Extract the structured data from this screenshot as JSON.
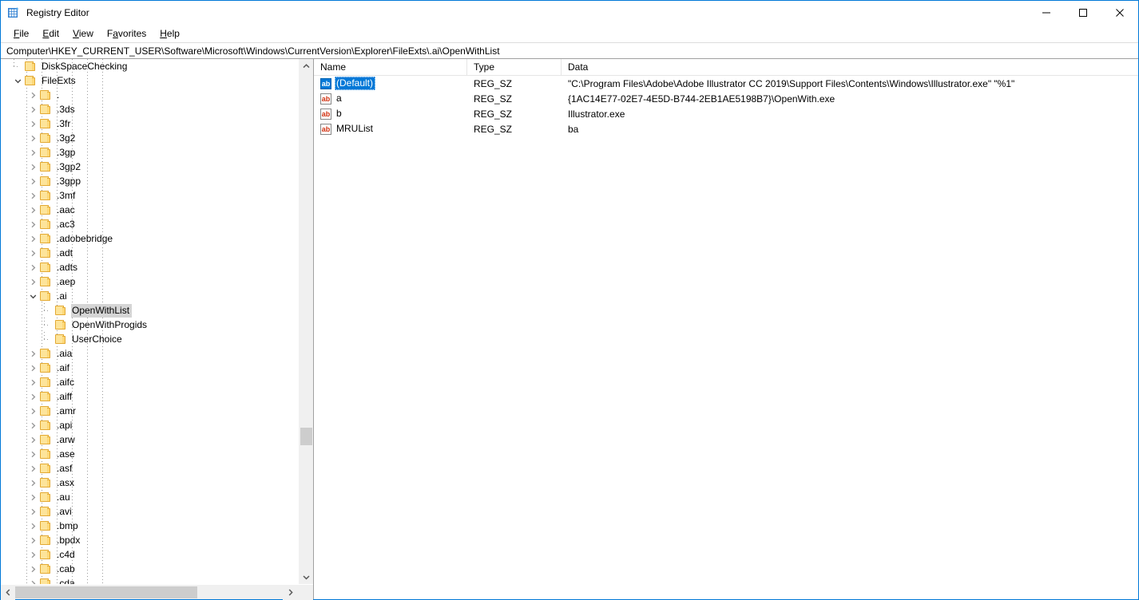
{
  "window": {
    "title": "Registry Editor",
    "app_icon": "registry-grid-icon",
    "minimize_label": "Minimize",
    "maximize_label": "Maximize",
    "close_label": "Close",
    "border_color": "#0078d7"
  },
  "menubar": {
    "items": [
      {
        "label": "File",
        "accesskey": "F"
      },
      {
        "label": "Edit",
        "accesskey": "E"
      },
      {
        "label": "View",
        "accesskey": "V"
      },
      {
        "label": "Favorites",
        "accesskey": "a"
      },
      {
        "label": "Help",
        "accesskey": "H"
      }
    ]
  },
  "addressbar": {
    "path": "Computer\\HKEY_CURRENT_USER\\Software\\Microsoft\\Windows\\CurrentVersion\\Explorer\\FileExts\\.ai\\OpenWithList"
  },
  "tree": {
    "selected_key": "OpenWithList",
    "ancestor_guide_count": 6,
    "nodes": [
      {
        "label": "DiskSpaceChecking",
        "indent": 6,
        "state": "leaf-elbow",
        "selected": false
      },
      {
        "label": "FileExts",
        "indent": 6,
        "state": "expanded",
        "selected": false
      },
      {
        "label": ".",
        "indent": 7,
        "state": "collapsed",
        "selected": false
      },
      {
        "label": ".3ds",
        "indent": 7,
        "state": "collapsed",
        "selected": false
      },
      {
        "label": ".3fr",
        "indent": 7,
        "state": "collapsed",
        "selected": false
      },
      {
        "label": ".3g2",
        "indent": 7,
        "state": "collapsed",
        "selected": false
      },
      {
        "label": ".3gp",
        "indent": 7,
        "state": "collapsed",
        "selected": false
      },
      {
        "label": ".3gp2",
        "indent": 7,
        "state": "collapsed",
        "selected": false
      },
      {
        "label": ".3gpp",
        "indent": 7,
        "state": "collapsed",
        "selected": false
      },
      {
        "label": ".3mf",
        "indent": 7,
        "state": "collapsed",
        "selected": false
      },
      {
        "label": ".aac",
        "indent": 7,
        "state": "collapsed",
        "selected": false
      },
      {
        "label": ".ac3",
        "indent": 7,
        "state": "collapsed",
        "selected": false
      },
      {
        "label": ".adobebridge",
        "indent": 7,
        "state": "collapsed",
        "selected": false
      },
      {
        "label": ".adt",
        "indent": 7,
        "state": "collapsed",
        "selected": false
      },
      {
        "label": ".adts",
        "indent": 7,
        "state": "collapsed",
        "selected": false
      },
      {
        "label": ".aep",
        "indent": 7,
        "state": "collapsed",
        "selected": false
      },
      {
        "label": ".ai",
        "indent": 7,
        "state": "expanded",
        "selected": false
      },
      {
        "label": "OpenWithList",
        "indent": 8,
        "state": "leaf-elbow",
        "selected": true
      },
      {
        "label": "OpenWithProgids",
        "indent": 8,
        "state": "leaf-elbow",
        "selected": false
      },
      {
        "label": "UserChoice",
        "indent": 8,
        "state": "leaf-elbow-last",
        "selected": false
      },
      {
        "label": ".aia",
        "indent": 7,
        "state": "collapsed",
        "selected": false
      },
      {
        "label": ".aif",
        "indent": 7,
        "state": "collapsed",
        "selected": false
      },
      {
        "label": ".aifc",
        "indent": 7,
        "state": "collapsed",
        "selected": false
      },
      {
        "label": ".aiff",
        "indent": 7,
        "state": "collapsed",
        "selected": false
      },
      {
        "label": ".amr",
        "indent": 7,
        "state": "collapsed",
        "selected": false
      },
      {
        "label": ".api",
        "indent": 7,
        "state": "collapsed",
        "selected": false
      },
      {
        "label": ".arw",
        "indent": 7,
        "state": "collapsed",
        "selected": false
      },
      {
        "label": ".ase",
        "indent": 7,
        "state": "collapsed",
        "selected": false
      },
      {
        "label": ".asf",
        "indent": 7,
        "state": "collapsed",
        "selected": false
      },
      {
        "label": ".asx",
        "indent": 7,
        "state": "collapsed",
        "selected": false
      },
      {
        "label": ".au",
        "indent": 7,
        "state": "collapsed",
        "selected": false
      },
      {
        "label": ".avi",
        "indent": 7,
        "state": "collapsed",
        "selected": false
      },
      {
        "label": ".bmp",
        "indent": 7,
        "state": "collapsed",
        "selected": false
      },
      {
        "label": ".bpdx",
        "indent": 7,
        "state": "collapsed",
        "selected": false
      },
      {
        "label": ".c4d",
        "indent": 7,
        "state": "collapsed",
        "selected": false
      },
      {
        "label": ".cab",
        "indent": 7,
        "state": "collapsed",
        "selected": false
      },
      {
        "label": ".cda",
        "indent": 7,
        "state": "collapsed",
        "selected": false
      }
    ],
    "vscroll": {
      "up_arrow": "chevron-up",
      "down_arrow": "chevron-down",
      "thumb_top_pct": 74
    },
    "hscroll": {
      "left_arrow": "chevron-left",
      "right_arrow": "chevron-right"
    }
  },
  "values": {
    "columns": [
      "Name",
      "Type",
      "Data"
    ],
    "rows": [
      {
        "name": "(Default)",
        "type": "REG_SZ",
        "data": "\"C:\\Program Files\\Adobe\\Adobe Illustrator CC 2019\\Support Files\\Contents\\Windows\\Illustrator.exe\" \"%1\"",
        "icon": "string-value-icon",
        "selected": true
      },
      {
        "name": "a",
        "type": "REG_SZ",
        "data": "{1AC14E77-02E7-4E5D-B744-2EB1AE5198B7}\\OpenWith.exe",
        "icon": "string-value-icon",
        "selected": false
      },
      {
        "name": "b",
        "type": "REG_SZ",
        "data": "Illustrator.exe",
        "icon": "string-value-icon",
        "selected": false
      },
      {
        "name": "MRUList",
        "type": "REG_SZ",
        "data": "ba",
        "icon": "string-value-icon",
        "selected": false
      }
    ],
    "icon_label": "ab",
    "selection_color": "#0078d7"
  }
}
